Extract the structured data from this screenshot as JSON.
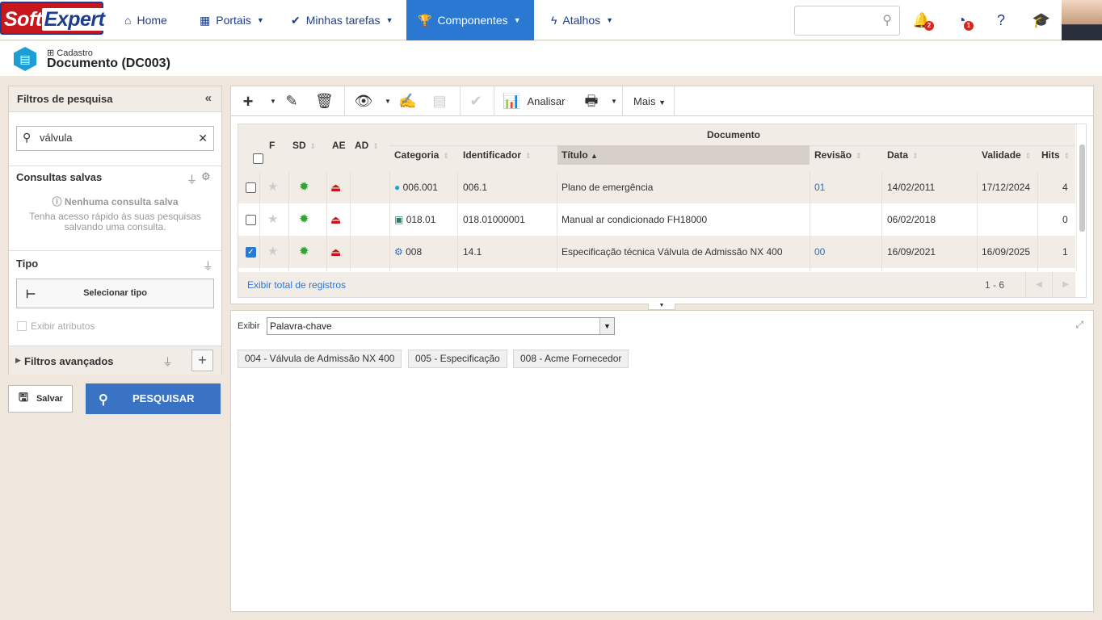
{
  "brand": {
    "logo_part1": "Soft",
    "logo_part2": "Expert"
  },
  "nav": {
    "home": "Home",
    "portals": "Portais",
    "tasks": "Minhas tarefas",
    "components": "Componentes",
    "shortcuts": "Atalhos",
    "notif_badge_1": "2",
    "notif_badge_2": "1"
  },
  "header": {
    "breadcrumb": "Cadastro",
    "title": "Documento (DC003)"
  },
  "filters": {
    "title": "Filtros de pesquisa",
    "search_value": "válvula",
    "saved_title": "Consultas salvas",
    "saved_empty": "Nenhuma consulta salva",
    "saved_hint": "Tenha acesso rápido às suas pesquisas salvando uma consulta.",
    "type_title": "Tipo",
    "select_type": "Selecionar tipo",
    "show_attrs": "Exibir atributos",
    "advanced": "Filtros avançados",
    "save_btn": "Salvar",
    "search_btn": "PESQUISAR"
  },
  "toolbar": {
    "analyze": "Analisar",
    "more": "Mais"
  },
  "grid": {
    "group_header": "Documento",
    "columns": {
      "f": "F",
      "sd": "SD",
      "ae": "AE",
      "ad": "AD",
      "category": "Categoria",
      "identifier": "Identificador",
      "title": "Título",
      "revision": "Revisão",
      "date": "Data",
      "validity": "Validade",
      "hits": "Hits"
    },
    "rows": [
      {
        "category": "006.001",
        "identifier": "006.1",
        "title": "Plano de emergência",
        "revision": "01",
        "date": "14/02/2011",
        "validity": "17/12/2024",
        "hits": "4",
        "checked": false
      },
      {
        "category": "018.01",
        "identifier": "018.01000001",
        "title": "Manual ar condicionado FH18000",
        "revision": "",
        "date": "06/02/2018",
        "validity": "",
        "hits": "0",
        "checked": false
      },
      {
        "category": "008",
        "identifier": "14.1",
        "title": "Especificação técnica Válvula de Admissão NX 400",
        "revision": "00",
        "date": "16/09/2021",
        "validity": "16/09/2025",
        "hits": "1",
        "checked": true
      }
    ],
    "total_link": "Exibir total de registros",
    "paging": "1 - 6"
  },
  "detail": {
    "show_label": "Exibir",
    "show_value": "Palavra-chave",
    "tags": [
      "004 - Válvula de Admissão NX 400",
      "005 - Especificação",
      "008 - Acme Fornecedor"
    ]
  },
  "colors": {
    "accent": "#2a78d2",
    "brand_red": "#c8161d",
    "brand_blue": "#1d3e8f",
    "panel_bg": "#efe7de"
  }
}
